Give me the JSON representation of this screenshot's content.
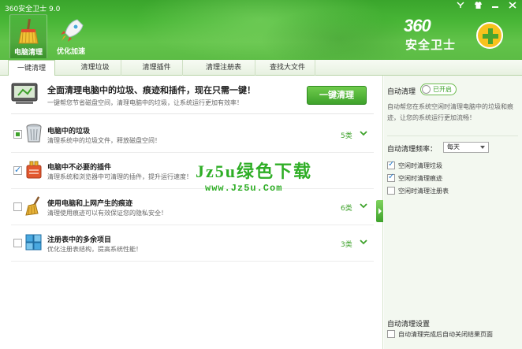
{
  "app": {
    "title": "360安全卫士 9.0"
  },
  "window_controls": [
    "menu-icon",
    "skin-icon",
    "minimize-icon",
    "close-icon"
  ],
  "nav": [
    {
      "label": "电脑清理",
      "icon": "broom-icon",
      "active": true
    },
    {
      "label": "优化加速",
      "icon": "rocket-icon",
      "active": false
    }
  ],
  "logo": {
    "line1": "360",
    "line2": "安全卫士"
  },
  "tabs": [
    "一键清理",
    "清理垃圾",
    "清理插件",
    "清理注册表",
    "查找大文件"
  ],
  "hero": {
    "title": "全面清理电脑中的垃圾、痕迹和插件，现在只需一键！",
    "desc": "一键帮您节省磁盘空间，清理电脑中的垃圾，让系统运行更加有效率！",
    "button": "一键清理"
  },
  "items": [
    {
      "title": "电脑中的垃圾",
      "desc": "清理系统中的垃圾文件，释放磁盘空间！",
      "count": "5类",
      "state": "partial",
      "icon": "trash-can-icon"
    },
    {
      "title": "电脑中不必要的插件",
      "desc": "清理系统和浏览器中可清理的插件，提升运行速度！",
      "count": "",
      "state": "checked",
      "icon": "plugin-icon"
    },
    {
      "title": "使用电脑和上网产生的痕迹",
      "desc": "清理使用痕迹可以有效保证您的隐私安全！",
      "count": "6类",
      "state": "unchecked",
      "icon": "broom-icon"
    },
    {
      "title": "注册表中的多余项目",
      "desc": "优化注册表结构，提高系统性能！",
      "count": "3类",
      "state": "unchecked",
      "icon": "registry-cubes-icon"
    }
  ],
  "watermark": {
    "text": "Jz5u绿色下载",
    "url": "www.Jz5u.Com"
  },
  "side": {
    "auto_clean_label": "自动清理",
    "toggle_text": "已开启",
    "auto_desc": "自动帮您在系统空闲时清理电脑中的垃圾和痕迹，让您的系统运行更加流畅！",
    "freq_label": "自动清理频率：",
    "freq_value": "每天",
    "options": [
      {
        "label": "空闲时清理垃圾",
        "checked": true
      },
      {
        "label": "空闲时清理痕迹",
        "checked": true
      },
      {
        "label": "空闲时清理注册表",
        "checked": false
      }
    ],
    "settings_label": "自动清理设置",
    "settings_option": {
      "label": "自动清理完成后自动关闭结果页面",
      "checked": false
    }
  },
  "colors": {
    "header_green": "#48b636",
    "accent_green": "#3ea22b",
    "count_green": "#3ea22b"
  }
}
